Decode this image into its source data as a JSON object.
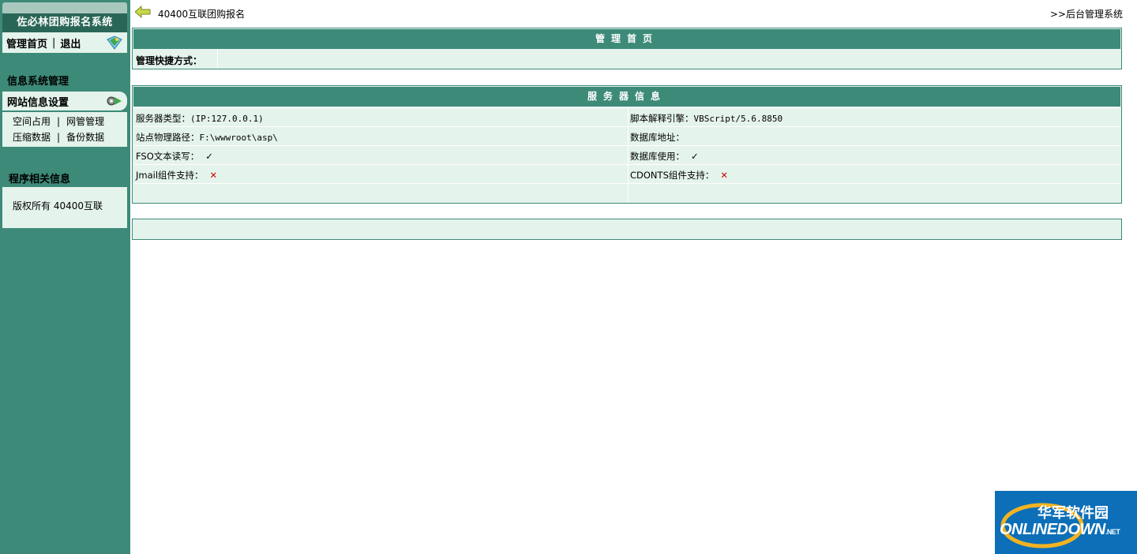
{
  "sidebar": {
    "title": "佐必林团购报名系统",
    "nav": {
      "home": "管理首页",
      "separator": "|",
      "logout": "退出"
    },
    "section_info": "信息系统管理",
    "menu_head": "网站信息设置",
    "menu_items": [
      {
        "left": "空间占用",
        "right": "网管管理"
      },
      {
        "left": "压缩数据",
        "right": "备份数据"
      }
    ],
    "section_program": "程序相关信息",
    "copyright": "版权所有 40400互联"
  },
  "topbar": {
    "site_name": "40400互联团购报名",
    "right_text": ">>后台管理系统"
  },
  "admin_panel": {
    "title": "管理首页",
    "shortcut_label": "管理快捷方式："
  },
  "server_panel": {
    "title": "服务器信息",
    "rows": [
      {
        "l_label": "服务器类型：",
        "l_value": "(IP:127.0.0.1)",
        "r_label": "脚本解释引擎：",
        "r_value": "VBScript/5.6.8850"
      },
      {
        "l_label": "站点物理路径：",
        "l_value": "F:\\wwwroot\\asp\\",
        "r_label": "数据库地址：",
        "r_value": ""
      },
      {
        "l_label": "FSO文本读写：",
        "l_value": "✓",
        "r_label": "数据库使用：",
        "r_value": "✓"
      },
      {
        "l_label": "Jmail组件支持：",
        "l_value": "✕",
        "r_label": "CDONTS组件支持：",
        "r_value": "✕"
      }
    ]
  },
  "watermark": {
    "cn": "华军软件园",
    "en": "ONLINEDOWN",
    "suffix": ".NET"
  },
  "colors": {
    "sidebar": "#3d8a78",
    "header": "#2a6657",
    "panel_bg": "#e4f3ec",
    "no_mark": "#cc0000"
  },
  "icons": [
    "map-gem-icon",
    "gear-icon",
    "back-arrow-icon"
  ]
}
